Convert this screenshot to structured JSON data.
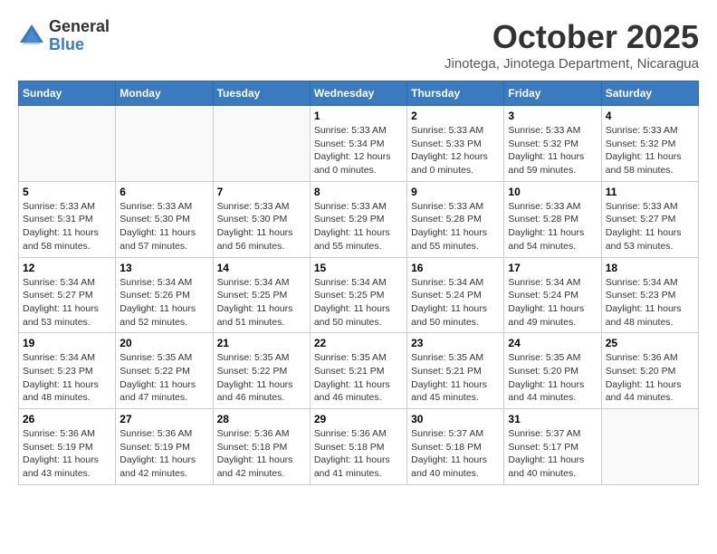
{
  "logo": {
    "general": "General",
    "blue": "Blue"
  },
  "title": "October 2025",
  "location": "Jinotega, Jinotega Department, Nicaragua",
  "days_of_week": [
    "Sunday",
    "Monday",
    "Tuesday",
    "Wednesday",
    "Thursday",
    "Friday",
    "Saturday"
  ],
  "weeks": [
    [
      {
        "day": "",
        "info": ""
      },
      {
        "day": "",
        "info": ""
      },
      {
        "day": "",
        "info": ""
      },
      {
        "day": "1",
        "info": "Sunrise: 5:33 AM\nSunset: 5:34 PM\nDaylight: 12 hours\nand 0 minutes."
      },
      {
        "day": "2",
        "info": "Sunrise: 5:33 AM\nSunset: 5:33 PM\nDaylight: 12 hours\nand 0 minutes."
      },
      {
        "day": "3",
        "info": "Sunrise: 5:33 AM\nSunset: 5:32 PM\nDaylight: 11 hours\nand 59 minutes."
      },
      {
        "day": "4",
        "info": "Sunrise: 5:33 AM\nSunset: 5:32 PM\nDaylight: 11 hours\nand 58 minutes."
      }
    ],
    [
      {
        "day": "5",
        "info": "Sunrise: 5:33 AM\nSunset: 5:31 PM\nDaylight: 11 hours\nand 58 minutes."
      },
      {
        "day": "6",
        "info": "Sunrise: 5:33 AM\nSunset: 5:30 PM\nDaylight: 11 hours\nand 57 minutes."
      },
      {
        "day": "7",
        "info": "Sunrise: 5:33 AM\nSunset: 5:30 PM\nDaylight: 11 hours\nand 56 minutes."
      },
      {
        "day": "8",
        "info": "Sunrise: 5:33 AM\nSunset: 5:29 PM\nDaylight: 11 hours\nand 55 minutes."
      },
      {
        "day": "9",
        "info": "Sunrise: 5:33 AM\nSunset: 5:28 PM\nDaylight: 11 hours\nand 55 minutes."
      },
      {
        "day": "10",
        "info": "Sunrise: 5:33 AM\nSunset: 5:28 PM\nDaylight: 11 hours\nand 54 minutes."
      },
      {
        "day": "11",
        "info": "Sunrise: 5:33 AM\nSunset: 5:27 PM\nDaylight: 11 hours\nand 53 minutes."
      }
    ],
    [
      {
        "day": "12",
        "info": "Sunrise: 5:34 AM\nSunset: 5:27 PM\nDaylight: 11 hours\nand 53 minutes."
      },
      {
        "day": "13",
        "info": "Sunrise: 5:34 AM\nSunset: 5:26 PM\nDaylight: 11 hours\nand 52 minutes."
      },
      {
        "day": "14",
        "info": "Sunrise: 5:34 AM\nSunset: 5:25 PM\nDaylight: 11 hours\nand 51 minutes."
      },
      {
        "day": "15",
        "info": "Sunrise: 5:34 AM\nSunset: 5:25 PM\nDaylight: 11 hours\nand 50 minutes."
      },
      {
        "day": "16",
        "info": "Sunrise: 5:34 AM\nSunset: 5:24 PM\nDaylight: 11 hours\nand 50 minutes."
      },
      {
        "day": "17",
        "info": "Sunrise: 5:34 AM\nSunset: 5:24 PM\nDaylight: 11 hours\nand 49 minutes."
      },
      {
        "day": "18",
        "info": "Sunrise: 5:34 AM\nSunset: 5:23 PM\nDaylight: 11 hours\nand 48 minutes."
      }
    ],
    [
      {
        "day": "19",
        "info": "Sunrise: 5:34 AM\nSunset: 5:23 PM\nDaylight: 11 hours\nand 48 minutes."
      },
      {
        "day": "20",
        "info": "Sunrise: 5:35 AM\nSunset: 5:22 PM\nDaylight: 11 hours\nand 47 minutes."
      },
      {
        "day": "21",
        "info": "Sunrise: 5:35 AM\nSunset: 5:22 PM\nDaylight: 11 hours\nand 46 minutes."
      },
      {
        "day": "22",
        "info": "Sunrise: 5:35 AM\nSunset: 5:21 PM\nDaylight: 11 hours\nand 46 minutes."
      },
      {
        "day": "23",
        "info": "Sunrise: 5:35 AM\nSunset: 5:21 PM\nDaylight: 11 hours\nand 45 minutes."
      },
      {
        "day": "24",
        "info": "Sunrise: 5:35 AM\nSunset: 5:20 PM\nDaylight: 11 hours\nand 44 minutes."
      },
      {
        "day": "25",
        "info": "Sunrise: 5:36 AM\nSunset: 5:20 PM\nDaylight: 11 hours\nand 44 minutes."
      }
    ],
    [
      {
        "day": "26",
        "info": "Sunrise: 5:36 AM\nSunset: 5:19 PM\nDaylight: 11 hours\nand 43 minutes."
      },
      {
        "day": "27",
        "info": "Sunrise: 5:36 AM\nSunset: 5:19 PM\nDaylight: 11 hours\nand 42 minutes."
      },
      {
        "day": "28",
        "info": "Sunrise: 5:36 AM\nSunset: 5:18 PM\nDaylight: 11 hours\nand 42 minutes."
      },
      {
        "day": "29",
        "info": "Sunrise: 5:36 AM\nSunset: 5:18 PM\nDaylight: 11 hours\nand 41 minutes."
      },
      {
        "day": "30",
        "info": "Sunrise: 5:37 AM\nSunset: 5:18 PM\nDaylight: 11 hours\nand 40 minutes."
      },
      {
        "day": "31",
        "info": "Sunrise: 5:37 AM\nSunset: 5:17 PM\nDaylight: 11 hours\nand 40 minutes."
      },
      {
        "day": "",
        "info": ""
      }
    ]
  ]
}
